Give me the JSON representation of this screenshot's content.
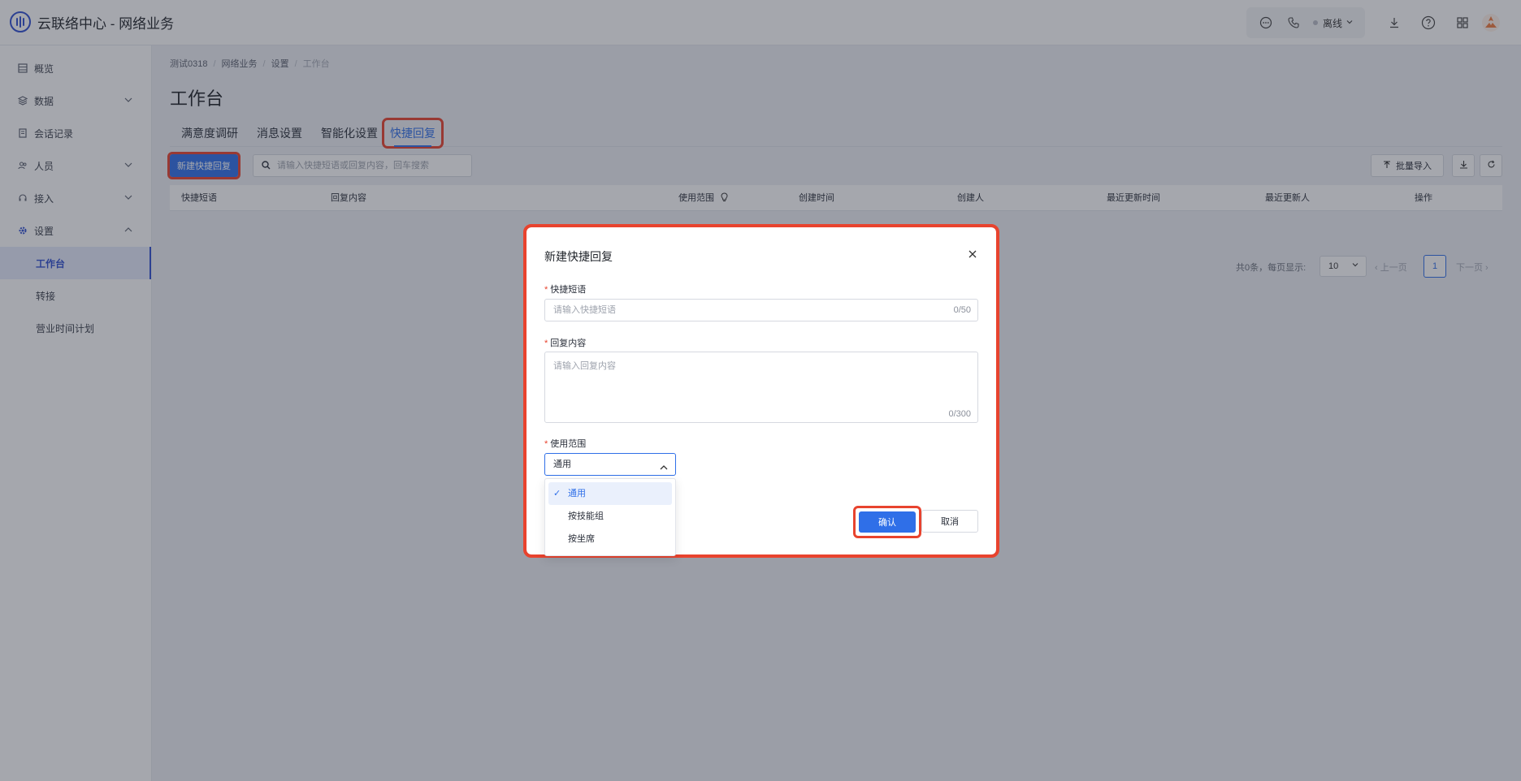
{
  "app": {
    "title": "云联络中心 - 网络业务"
  },
  "topbar": {
    "status": "离线"
  },
  "colors": {
    "accent": "#2f6fe8",
    "highlight": "#e8432e",
    "nav_active": "#2f4fd1"
  },
  "sidebar": {
    "items": [
      {
        "label": "概览",
        "icon": "overview-icon"
      },
      {
        "label": "数据",
        "icon": "data-icon"
      },
      {
        "label": "会话记录",
        "icon": "session-icon"
      },
      {
        "label": "人员",
        "icon": "people-icon"
      },
      {
        "label": "接入",
        "icon": "headset-icon"
      },
      {
        "label": "设置",
        "icon": "gear-icon"
      }
    ],
    "sub_items": [
      {
        "label": "工作台"
      },
      {
        "label": "转接"
      },
      {
        "label": "营业时间计划"
      }
    ]
  },
  "breadcrumb": [
    "测试0318",
    "网络业务",
    "设置",
    "工作台"
  ],
  "page": {
    "title": "工作台"
  },
  "tabs": [
    {
      "label": "满意度调研"
    },
    {
      "label": "消息设置"
    },
    {
      "label": "智能化设置"
    },
    {
      "label": "快捷回复"
    }
  ],
  "toolbar": {
    "new_label": "新建快捷回复",
    "search_placeholder": "请输入快捷短语或回复内容，回车搜索",
    "import_label": "批量导入"
  },
  "table": {
    "columns": [
      "快捷短语",
      "回复内容",
      "使用范围",
      "创建时间",
      "创建人",
      "最近更新时间",
      "最近更新人",
      "操作"
    ]
  },
  "pagination": {
    "total": "共0条，每页显示:",
    "page_size": "10",
    "prev": "上一页",
    "current": "1",
    "next": "下一页"
  },
  "modal": {
    "title": "新建快捷回复",
    "phrase_label": "快捷短语",
    "phrase_placeholder": "请输入快捷短语",
    "phrase_counter": "0/50",
    "content_label": "回复内容",
    "content_placeholder": "请输入回复内容",
    "content_counter": "0/300",
    "scope_label": "使用范围",
    "scope_value": "通用",
    "scope_options": [
      "通用",
      "按技能组",
      "按坐席"
    ],
    "confirm_label": "确认",
    "cancel_label": "取消"
  }
}
